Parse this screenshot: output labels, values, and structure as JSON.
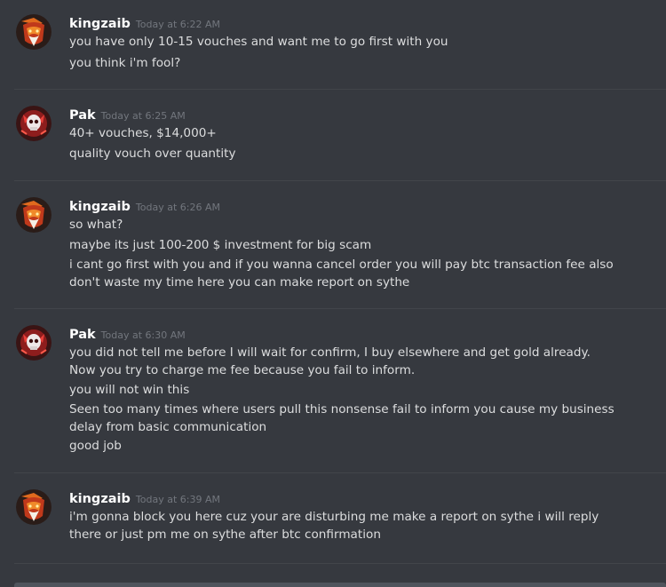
{
  "messages": [
    {
      "username": "kingzaib",
      "timestamp": "Today at 6:22 AM",
      "lines": [
        "you have only 10-15 vouches and want me  to go first with you",
        "you think i'm fool?"
      ]
    },
    {
      "username": "Pak",
      "timestamp": "Today at 6:25 AM",
      "lines": [
        "40+ vouches, $14,000+",
        "quality vouch over quantity"
      ]
    },
    {
      "username": "kingzaib",
      "timestamp": "Today at 6:26 AM",
      "lines": [
        "so what?",
        "maybe its just 100-200 $ investment for big scam",
        "i cant go first with you and if you wanna cancel order you will pay btc transaction fee also don't waste my time here you can make report on sythe"
      ]
    },
    {
      "username": "Pak",
      "timestamp": "Today at 6:30 AM",
      "lines": [
        "you did not tell me before I will wait for confirm, I buy elsewhere and get gold already. Now you try to charge me fee because you fail to inform.",
        "you will not win this",
        "Seen too many times where users pull this nonsense fail to inform you cause my business delay from basic communication",
        "good job"
      ]
    },
    {
      "username": "kingzaib",
      "timestamp": "Today at 6:39 AM",
      "lines": [
        "i'm gonna block you here cuz your are disturbing me  make a report on sythe i will reply there or just pm me on sythe after btc confirmation"
      ]
    }
  ]
}
